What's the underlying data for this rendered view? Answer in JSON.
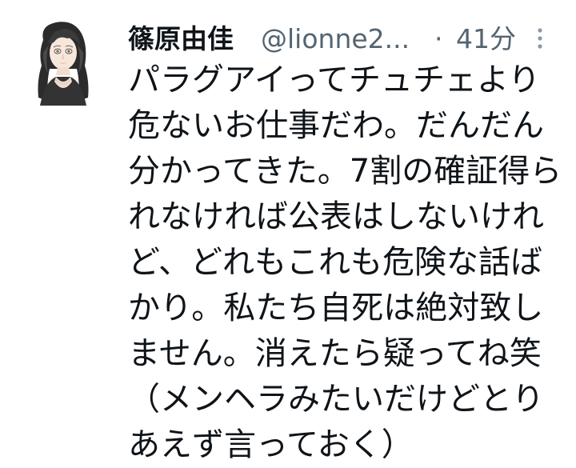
{
  "tweet": {
    "display_name": "篠原由佳",
    "handle": "@lionne2...",
    "separator": "·",
    "time": "41分",
    "more_icon": "more-vertical-icon",
    "avatar_icon": "user-avatar-illustration",
    "text_lines": [
      "パラグアイってチュチェより",
      "危ないお仕事だわ。だんだん",
      "分かってきた。7割の確証得ら",
      "れなければ公表はしないけれ",
      "ど、どれもこれも危険な話ば",
      "かり。私たち自死は絶対致し",
      "ません。消えたら疑ってね笑",
      "（メンヘラみたいだけどとり",
      "あえず言っておく）"
    ]
  },
  "colors": {
    "text_primary": "#0f1419",
    "text_secondary": "#536471",
    "background": "#ffffff"
  }
}
